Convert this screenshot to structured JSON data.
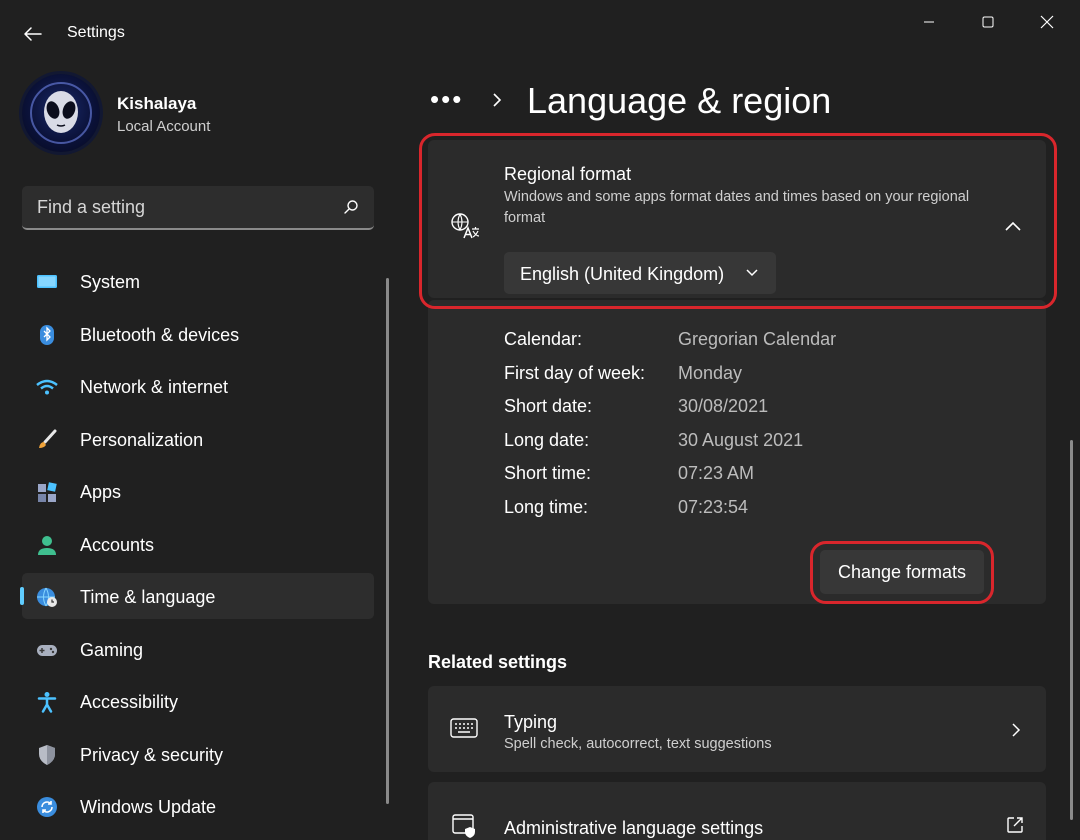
{
  "window": {
    "app_title": "Settings"
  },
  "profile": {
    "name": "Kishalaya",
    "account_type": "Local Account"
  },
  "search": {
    "placeholder": "Find a setting"
  },
  "sidebar": {
    "items": [
      {
        "label": "System",
        "icon": "monitor-icon",
        "selected": false
      },
      {
        "label": "Bluetooth & devices",
        "icon": "bluetooth-icon",
        "selected": false
      },
      {
        "label": "Network & internet",
        "icon": "wifi-icon",
        "selected": false
      },
      {
        "label": "Personalization",
        "icon": "brush-icon",
        "selected": false
      },
      {
        "label": "Apps",
        "icon": "apps-icon",
        "selected": false
      },
      {
        "label": "Accounts",
        "icon": "person-icon",
        "selected": false
      },
      {
        "label": "Time & language",
        "icon": "globe-clock-icon",
        "selected": true
      },
      {
        "label": "Gaming",
        "icon": "gamepad-icon",
        "selected": false
      },
      {
        "label": "Accessibility",
        "icon": "accessibility-icon",
        "selected": false
      },
      {
        "label": "Privacy & security",
        "icon": "shield-icon",
        "selected": false
      },
      {
        "label": "Windows Update",
        "icon": "update-icon",
        "selected": false
      }
    ]
  },
  "main": {
    "breadcrumb_dots": "•••",
    "title": "Language & region",
    "regional_format": {
      "title": "Regional format",
      "description": "Windows and some apps format dates and times based on your regional format",
      "selected_value": "English (United Kingdom)",
      "details": [
        {
          "label": "Calendar:",
          "value": "Gregorian Calendar"
        },
        {
          "label": "First day of week:",
          "value": "Monday"
        },
        {
          "label": "Short date:",
          "value": "30/08/2021"
        },
        {
          "label": "Long date:",
          "value": "30 August 2021"
        },
        {
          "label": "Short time:",
          "value": "07:23 AM"
        },
        {
          "label": "Long time:",
          "value": "07:23:54"
        }
      ],
      "change_button_label": "Change formats"
    },
    "related_settings": {
      "header": "Related settings",
      "typing": {
        "title": "Typing",
        "description": "Spell check, autocorrect, text suggestions"
      },
      "admin": {
        "title": "Administrative language settings"
      }
    }
  },
  "colors": {
    "accent": "#60cdff",
    "highlight": "#d9262c",
    "background": "#202020",
    "card": "#2b2b2b"
  }
}
